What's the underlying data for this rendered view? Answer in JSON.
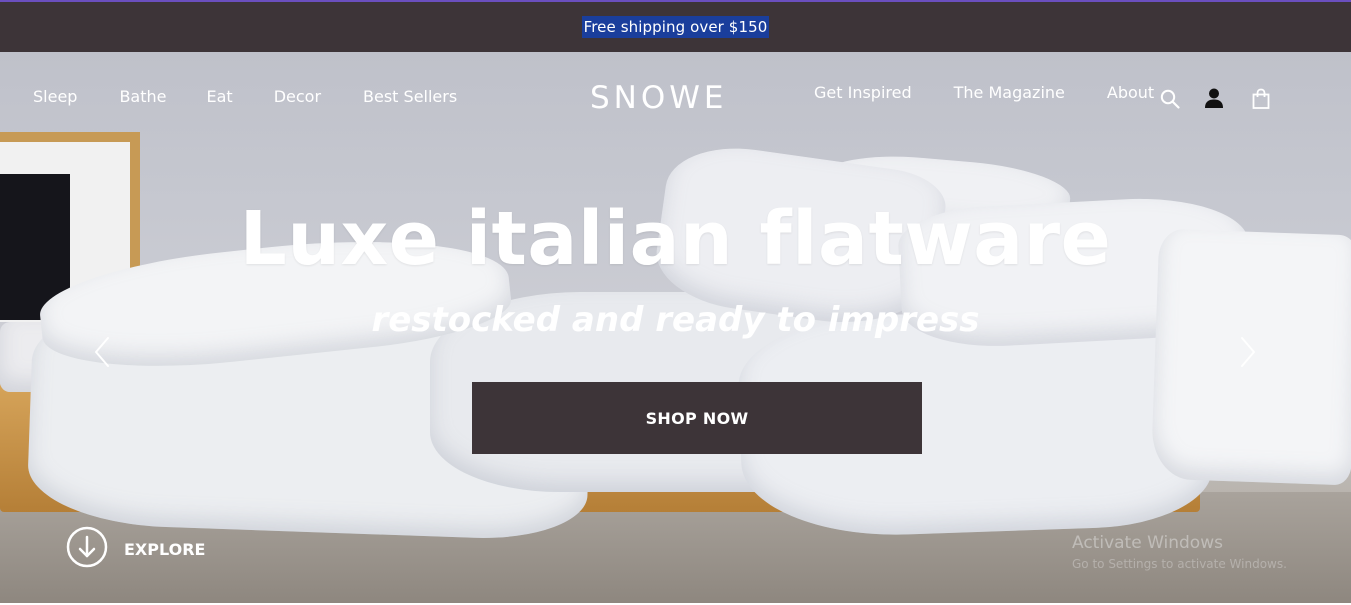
{
  "announcement": {
    "text": "Free shipping over $150"
  },
  "nav": {
    "left": [
      {
        "label": "Sleep"
      },
      {
        "label": "Bathe"
      },
      {
        "label": "Eat"
      },
      {
        "label": "Decor"
      },
      {
        "label": "Best Sellers"
      }
    ],
    "logo": "SNOWE",
    "right": [
      {
        "label": "Get Inspired"
      },
      {
        "label": "The Magazine"
      },
      {
        "label": "About"
      }
    ],
    "icons": [
      "search-icon",
      "account-icon",
      "shopping-bag-icon"
    ]
  },
  "hero": {
    "title": "Luxe italian flatware",
    "subtitle": "restocked and ready to impress",
    "cta_label": "SHOP NOW",
    "explore_label": "EXPLORE",
    "prev_icon": "chevron-left-icon",
    "next_icon": "chevron-right-icon"
  },
  "watermark": {
    "title": "Activate Windows",
    "subtitle": "Go to Settings to activate Windows."
  },
  "colors": {
    "announcement_bg": "#3d3438",
    "button_bg": "#3d3438",
    "highlight": "#1a3e9c",
    "text_on_dark": "#ffffff"
  }
}
